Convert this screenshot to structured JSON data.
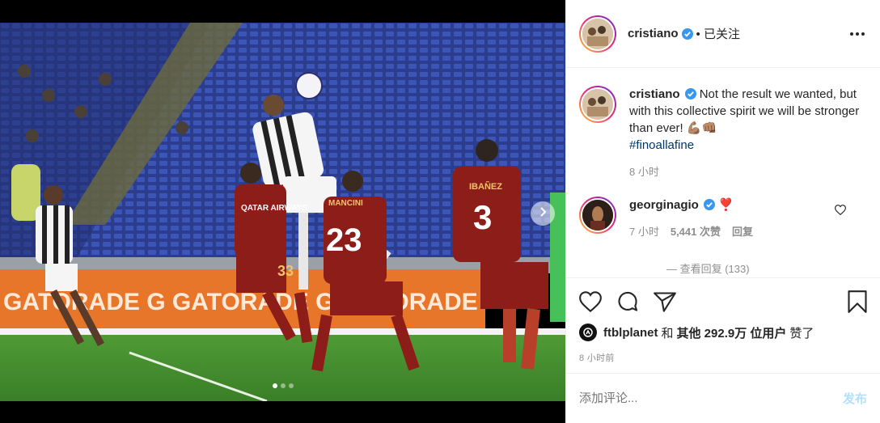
{
  "post": {
    "author": "cristiano",
    "follow_status": "• 已关注",
    "caption_text": "Not the result we wanted, but with this collective spirit we will be stronger than ever! 💪🏽👊🏽",
    "hashtag": "#finoallafine",
    "caption_time": "8 小时",
    "likes_line": {
      "first_liker": "ftblplanet",
      "and": "和",
      "others_label": "其他 292.9万 位用户",
      "liked": "赞了"
    },
    "posted_time": "8 小时前"
  },
  "comments": [
    {
      "username": "georginagio",
      "text": "❣️",
      "time": "7 小时",
      "likes": "5,441 次赞",
      "reply": "回复"
    }
  ],
  "view_replies": "— 查看回复 (133)",
  "composer": {
    "placeholder": "添加评论...",
    "post_label": "发布"
  },
  "photo": {
    "ad_boards": "GATORADE  G GATORADE  G GATORADE",
    "jersey_numbers": [
      "33",
      "23",
      "3"
    ],
    "jersey_names": [
      "MANCINI",
      "IBAÑEZ"
    ],
    "sponsor": "QATAR AIRWAYS",
    "slide_count": 3,
    "active_slide": 0
  },
  "colors": {
    "verified_blue": "#3897f0",
    "post_button_disabled": "#b2dffc",
    "hashtag_blue": "#00376b",
    "roma_red": "#8c1d18",
    "pitch_green": "#3f8a2e"
  }
}
